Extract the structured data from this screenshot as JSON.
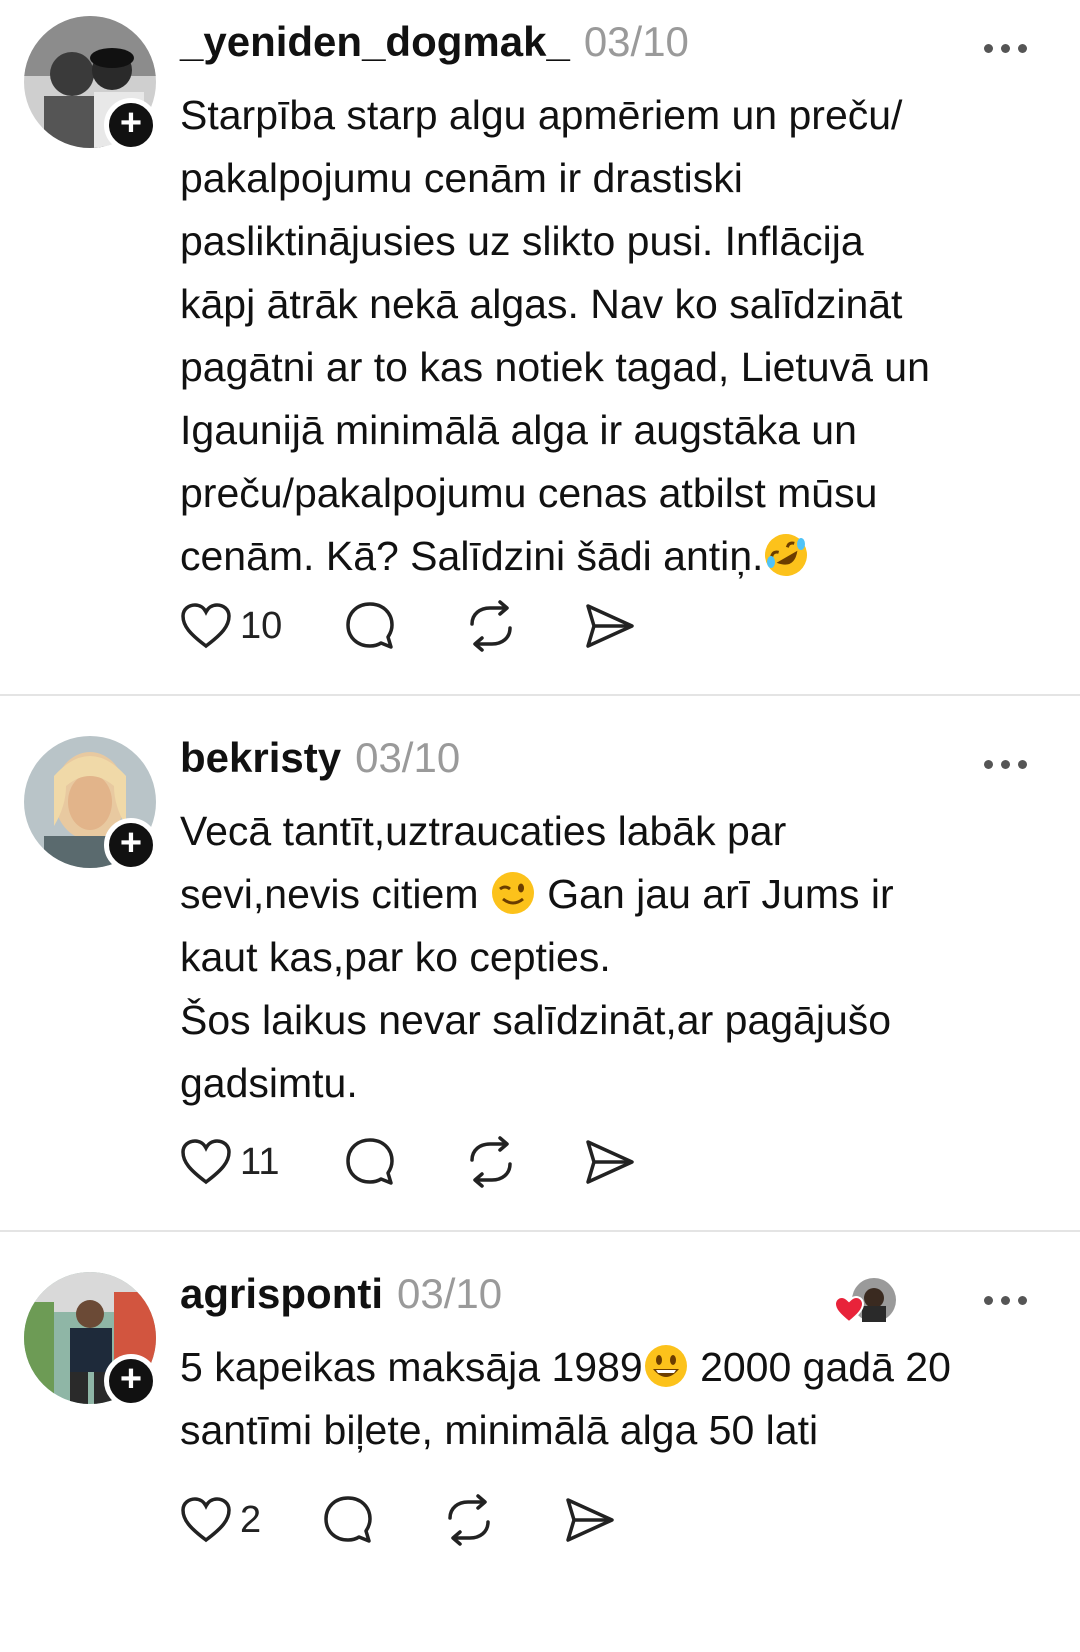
{
  "posts": [
    {
      "username": "_yeniden_dogmak_",
      "date": "03/10",
      "lines": [
        "Starpība starp algu apmēriem un preču/",
        "pakalpojumu cenām ir drastiski",
        "pasliktinājusies uz slikto pusi.  Inflācija",
        "kāpj ātrāk nekā algas. Nav ko salīdzināt",
        "pagātni ar to kas notiek tagad, Lietuvā un",
        "Igaunijā minimālā alga ir augstāka un",
        "preču/pakalpojumu cenas atbilst mūsu",
        "cenām. Kā? Salīdzini šādi antiņ."
      ],
      "emoji": "rolling-on-floor-laughing-emoji",
      "like_count": "10"
    },
    {
      "username": "bekristy",
      "date": "03/10",
      "lines": [
        "Vecā tantīt,uztraucaties labāk par",
        "sevi,nevis citiem",
        " Gan jau arī Jums ir",
        "kaut kas,par ko cepties.",
        "Šos laikus nevar salīdzināt,ar pagājušo",
        "gadsimtu."
      ],
      "emoji": "winking-face-emoji",
      "like_count": "11"
    },
    {
      "username": "agrisponti",
      "date": "03/10",
      "lines": [
        "5 kapeikas maksāja 1989",
        " 2000 gadā 20",
        "santīmi biļete, minimālā alga 50 lati"
      ],
      "emoji": "grinning-face-emoji",
      "like_count": "2"
    }
  ],
  "icons": {
    "like": "heart-outline-icon",
    "reply": "speech-bubble-icon",
    "repost": "repost-arrows-icon",
    "share": "paper-plane-icon",
    "follow": "plus-icon",
    "more": "ellipsis-icon"
  },
  "colors": {
    "text": "#111111",
    "muted": "#9a9a9a",
    "divider": "#e4e4e4",
    "liked_heart": "#e8233a"
  }
}
